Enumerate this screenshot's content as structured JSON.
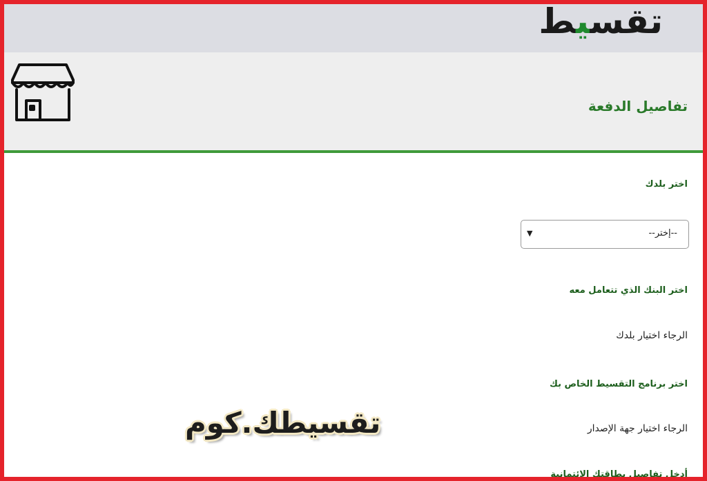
{
  "brand": {
    "logo_main": "تقس",
    "logo_accent": "ي",
    "logo_end": "ط"
  },
  "header": {
    "title": "تفاصيل الدفعة",
    "store_icon": "store-icon"
  },
  "form": {
    "country_label": "اختر بلدك",
    "country_select_value": "--إختر--",
    "country_select_arrow": "▼",
    "bank_label": "اختر البنك الذي تتعامل معه",
    "bank_help": "الرجاء اختيار بلدك",
    "plan_label": "اختر برنامج التقسيط الخاص بك",
    "plan_help": "الرجاء اختيار جهة الإصدار",
    "card_label": "أدخل تفاصيل بطاقتك الائتمانية"
  },
  "watermark": {
    "text": "تقسيطك.كوم"
  },
  "colors": {
    "frame_border": "#e5232b",
    "accent_green": "#3f9a3a",
    "title_green": "#2a7a2a",
    "topbar": "#dcdde3",
    "header_band": "#eeeeee"
  }
}
